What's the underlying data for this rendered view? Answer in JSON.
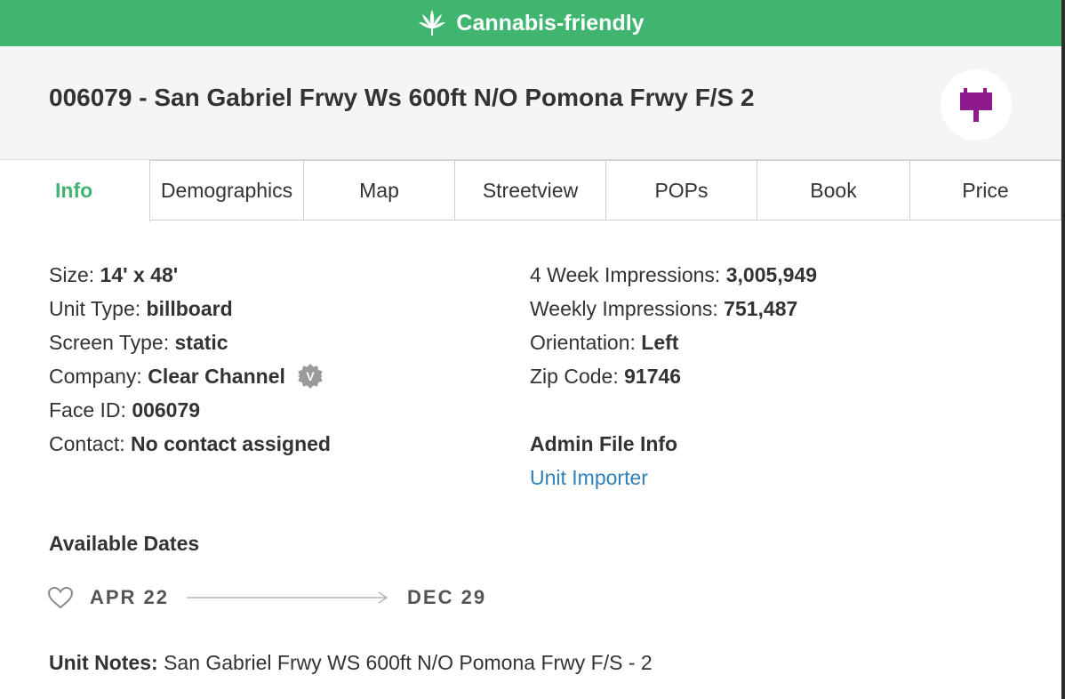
{
  "banner": {
    "label": "Cannabis-friendly",
    "icon": "cannabis-leaf-icon",
    "color": "#3fb56f"
  },
  "header": {
    "title": "006079 - San Gabriel Frwy Ws 600ft N/O Pomona Frwy F/S 2",
    "icon": "billboard-sign-icon",
    "icon_color": "#8e1a8e"
  },
  "tabs": [
    {
      "label": "Info",
      "active": true
    },
    {
      "label": "Demographics"
    },
    {
      "label": "Map"
    },
    {
      "label": "Streetview"
    },
    {
      "label": "POPs"
    },
    {
      "label": "Book"
    },
    {
      "label": "Price"
    }
  ],
  "info": {
    "size": {
      "label": "Size:",
      "value": "14' x 48'"
    },
    "unit_type": {
      "label": "Unit Type:",
      "value": "billboard"
    },
    "screen_type": {
      "label": "Screen Type:",
      "value": "static"
    },
    "company": {
      "label": "Company:",
      "value": "Clear Channel",
      "verified_badge": "V"
    },
    "face_id": {
      "label": "Face ID:",
      "value": "006079"
    },
    "contact": {
      "label": "Contact:",
      "value": "No contact assigned"
    }
  },
  "stats": {
    "four_week": {
      "label": "4 Week Impressions:",
      "value": "3,005,949"
    },
    "weekly": {
      "label": "Weekly Impressions:",
      "value": "751,487"
    },
    "orientation": {
      "label": "Orientation:",
      "value": "Left"
    },
    "zip": {
      "label": "Zip Code:",
      "value": "91746"
    }
  },
  "admin": {
    "title": "Admin File Info",
    "link": "Unit Importer",
    "link_color": "#2f7fb8"
  },
  "availability": {
    "title": "Available Dates",
    "start": "APR 22",
    "end": "DEC 29"
  },
  "notes": {
    "label": "Unit Notes:",
    "value": "San Gabriel Frwy WS 600ft N/O Pomona Frwy F/S - 2"
  }
}
